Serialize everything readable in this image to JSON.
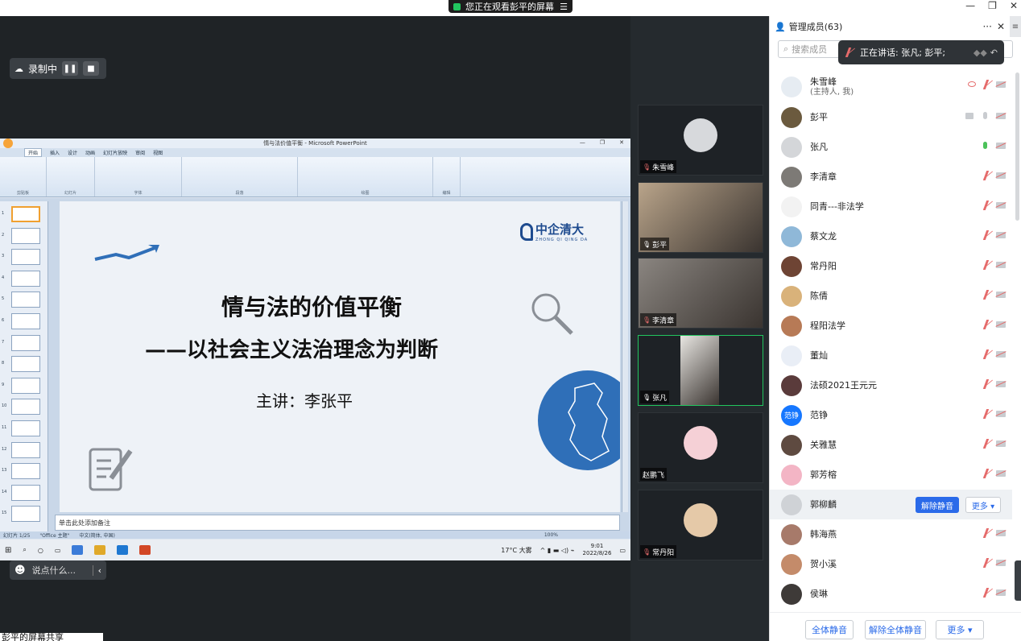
{
  "window": {
    "share_banner": "您正在观看彭平的屏幕",
    "min": "—",
    "restore": "❐",
    "close": "✕"
  },
  "recording": {
    "label": "录制中"
  },
  "chat": {
    "placeholder": "说点什么..."
  },
  "share_label": "彭平的屏幕共享",
  "ppt": {
    "window_title": "情与法价值平衡 - Microsoft PowerPoint",
    "tabs": [
      "开始",
      "插入",
      "设计",
      "动画",
      "幻灯片放映",
      "审阅",
      "视图"
    ],
    "ribbon_groups": [
      "剪贴板",
      "幻灯片",
      "字体",
      "段落",
      "绘图",
      "编辑"
    ],
    "slide": {
      "title": "情与法的价值平衡",
      "subtitle": "——以社会主义法治理念为判断",
      "speaker": "主讲：李张平",
      "logo_cn": "中企清大",
      "logo_en": "ZHONG QI QING DA"
    },
    "notes_placeholder": "单击此处添加备注",
    "status": {
      "slide_pos": "幻灯片 1/25",
      "theme": "\"Office 主题\"",
      "lang": "中文(简体, 中国)",
      "zoom": "100%"
    },
    "thumb_numbers": [
      "1",
      "2",
      "3",
      "4",
      "5",
      "6",
      "7",
      "8",
      "9",
      "10",
      "11",
      "12",
      "13",
      "14",
      "15"
    ]
  },
  "taskbar": {
    "weather": "17°C 大雾",
    "time": "9:01",
    "date": "2022/8/26"
  },
  "videos": [
    {
      "name": "朱雪峰",
      "mic": "off",
      "type": "avatar"
    },
    {
      "name": "彭平",
      "mic": "on",
      "type": "camera"
    },
    {
      "name": "李清章",
      "mic": "off",
      "type": "camera"
    },
    {
      "name": "张凡",
      "mic": "on",
      "type": "camera"
    },
    {
      "name": "赵鹏飞",
      "mic": "none",
      "type": "avatar"
    },
    {
      "name": "常丹阳",
      "mic": "off",
      "type": "avatar"
    }
  ],
  "panel": {
    "title": "管理成员(63)",
    "more": "···",
    "close": "✕",
    "side_menu": "≡",
    "search_placeholder": "搜索成员",
    "speaking": "正在讲话: 张凡; 彭平;",
    "members": [
      {
        "name": "朱雪峰",
        "sub": "(主持人, 我)",
        "color": "#e6ecf2"
      },
      {
        "name": "彭平",
        "sub": "",
        "color": "#6b5a3e"
      },
      {
        "name": "张凡",
        "sub": "",
        "color": "#d4d6d9"
      },
      {
        "name": "李清章",
        "sub": "",
        "color": "#7d7a76"
      },
      {
        "name": "同青---非法学",
        "sub": "",
        "color": "#f2f2f2"
      },
      {
        "name": "蔡文龙",
        "sub": "",
        "color": "#8fb8d8"
      },
      {
        "name": "常丹阳",
        "sub": "",
        "color": "#6e4434"
      },
      {
        "name": "陈倩",
        "sub": "",
        "color": "#d9b27a"
      },
      {
        "name": "程阳法学",
        "sub": "",
        "color": "#b77a56"
      },
      {
        "name": "董灿",
        "sub": "",
        "color": "#e9eef6"
      },
      {
        "name": "法硕2021王元元",
        "sub": "",
        "color": "#5a3b3b"
      },
      {
        "name": "范铮",
        "sub": "",
        "color": "#1677ff",
        "initials": "范铮"
      },
      {
        "name": "关雅慧",
        "sub": "",
        "color": "#5e4a40"
      },
      {
        "name": "郭芳榕",
        "sub": "",
        "color": "#f3b5c5"
      },
      {
        "name": "郭柳麟",
        "sub": "",
        "color": "#cfd2d6"
      },
      {
        "name": "韩海燕",
        "sub": "",
        "color": "#a77a6a"
      },
      {
        "name": "贺小溪",
        "sub": "",
        "color": "#c48b6a"
      },
      {
        "name": "侯琳",
        "sub": "",
        "color": "#3e3a38"
      }
    ],
    "unmute_button": "解除静音",
    "more_button": "更多 ▾",
    "footer": {
      "mute_all": "全体静音",
      "unmute_all": "解除全体静音",
      "more": "更多 ▾"
    }
  }
}
